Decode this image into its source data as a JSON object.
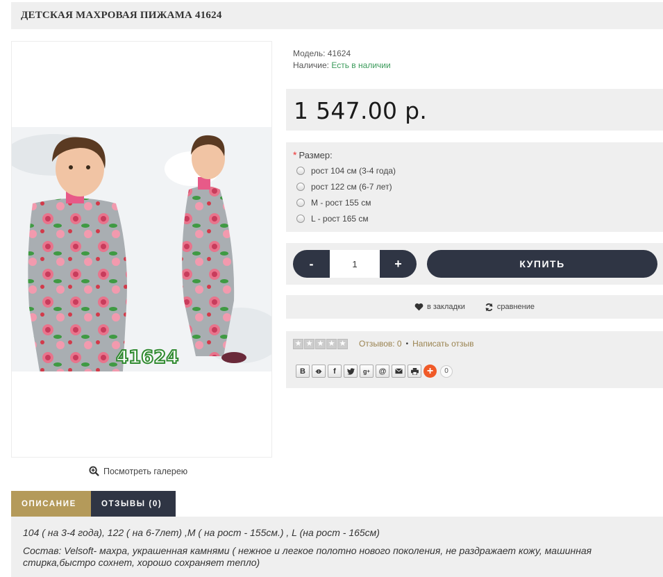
{
  "product": {
    "title": "ДЕТСКАЯ МАХРОВАЯ ПИЖАМА 41624",
    "image_code": "41624",
    "gallery_link": "Посмотреть галерею",
    "model_label": "Модель:",
    "model_value": "41624",
    "availability_label": "Наличие:",
    "availability_value": "Есть в наличии",
    "price": "1 547.00 р."
  },
  "options": {
    "label": "Размер:",
    "required_mark": "*",
    "items": [
      "рост 104 см (3-4 года)",
      "рост 122 см (6-7 лет)",
      "M - рост 155 см",
      "L - рост 165 см"
    ]
  },
  "purchase": {
    "minus": "-",
    "plus": "+",
    "quantity": "1",
    "buy_label": "КУПИТЬ"
  },
  "actions": {
    "wishlist": "в закладки",
    "compare": "сравнение"
  },
  "reviews": {
    "count_text": "Отзывов: 0",
    "separator": "•",
    "write_text": "Написать отзыв",
    "rating": 0
  },
  "share": {
    "buttons": [
      "B",
      "ok",
      "f",
      "tw",
      "g+",
      "@",
      "mail",
      "print"
    ],
    "count": "0"
  },
  "tabs": [
    {
      "label": "ОПИСАНИЕ",
      "active": true
    },
    {
      "label": "ОТЗЫВЫ (0)",
      "active": false
    }
  ],
  "description": {
    "line1": "104 ( на 3-4 года), 122 ( на 6-7лет) ,M ( на рост - 155см.) , L (на рост - 165см)",
    "line2": "Состав:  Velsoft- махра, украшенная камнями ( нежное и легкое полотно нового поколения, не раздражает кожу, машинная стирка,быстро сохнет, хорошо сохраняет тепло)"
  },
  "colors": {
    "dark": "#2f3544",
    "accent": "#b49a5a",
    "in_stock": "#3a9a5a",
    "panel": "#efefef"
  }
}
